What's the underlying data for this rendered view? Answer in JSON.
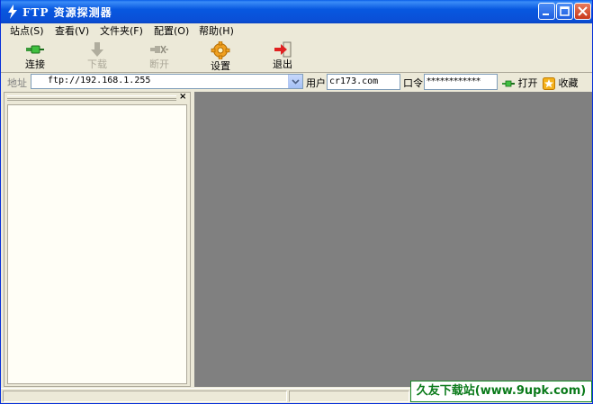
{
  "window": {
    "title": "FTP 资源探测器",
    "accent": "#0a4fd6",
    "controls": [
      "minimize-icon",
      "maximize-icon",
      "close-icon"
    ]
  },
  "menu": [
    {
      "label": "站点(S)"
    },
    {
      "label": "查看(V)"
    },
    {
      "label": "文件夹(F)"
    },
    {
      "label": "配置(O)"
    },
    {
      "label": "帮助(H)"
    }
  ],
  "toolbar": {
    "connect": {
      "label": "连接",
      "icon": "connect-plug-icon",
      "enabled": true
    },
    "download": {
      "label": "下载",
      "icon": "download-arrow-icon",
      "enabled": false
    },
    "disconnect": {
      "label": "断开",
      "icon": "disconnect-plug-icon",
      "enabled": false
    },
    "settings": {
      "label": "设置",
      "icon": "gear-icon",
      "enabled": true
    },
    "exit": {
      "label": "退出",
      "icon": "exit-arrow-icon",
      "enabled": true
    }
  },
  "address": {
    "label": "地址",
    "value": "ftp://192.168.1.255",
    "user_label": "用户",
    "user_value": "cr173.com",
    "password_label": "口令",
    "password_value": "************",
    "open_label": "打开",
    "favorite_label": "收藏"
  },
  "panes": {
    "left_close": "×",
    "right_bg": "#808080"
  },
  "watermark": "久友下载站(www.9upk.com)"
}
